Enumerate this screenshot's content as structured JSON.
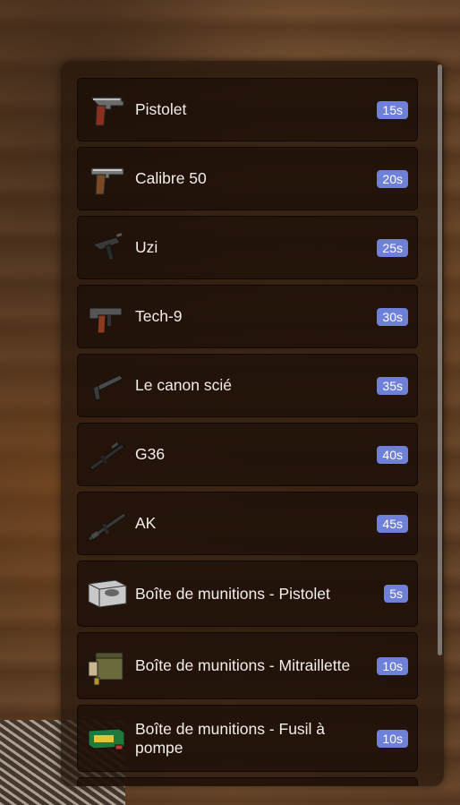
{
  "items": [
    {
      "label": "Pistolet",
      "time": "15s",
      "icon": "pistol-icon"
    },
    {
      "label": "Calibre 50",
      "time": "20s",
      "icon": "deagle-icon"
    },
    {
      "label": "Uzi",
      "time": "25s",
      "icon": "uzi-icon"
    },
    {
      "label": "Tech-9",
      "time": "30s",
      "icon": "tec9-icon"
    },
    {
      "label": "Le canon scié",
      "time": "35s",
      "icon": "sawed-off-shotgun-icon"
    },
    {
      "label": "G36",
      "time": "40s",
      "icon": "g36-icon"
    },
    {
      "label": "AK",
      "time": "45s",
      "icon": "ak-icon"
    },
    {
      "label": "Boîte de munitions - Pistolet",
      "time": "5s",
      "icon": "ammo-box-pistol-icon"
    },
    {
      "label": "Boîte de munitions - Mitraillette",
      "time": "10s",
      "icon": "ammo-box-smg-icon"
    },
    {
      "label": "Boîte de munitions - Fusil à pompe",
      "time": "10s",
      "icon": "ammo-box-shotgun-icon"
    }
  ],
  "colors": {
    "badge": "#6f80d9",
    "panel": "#26160c"
  }
}
